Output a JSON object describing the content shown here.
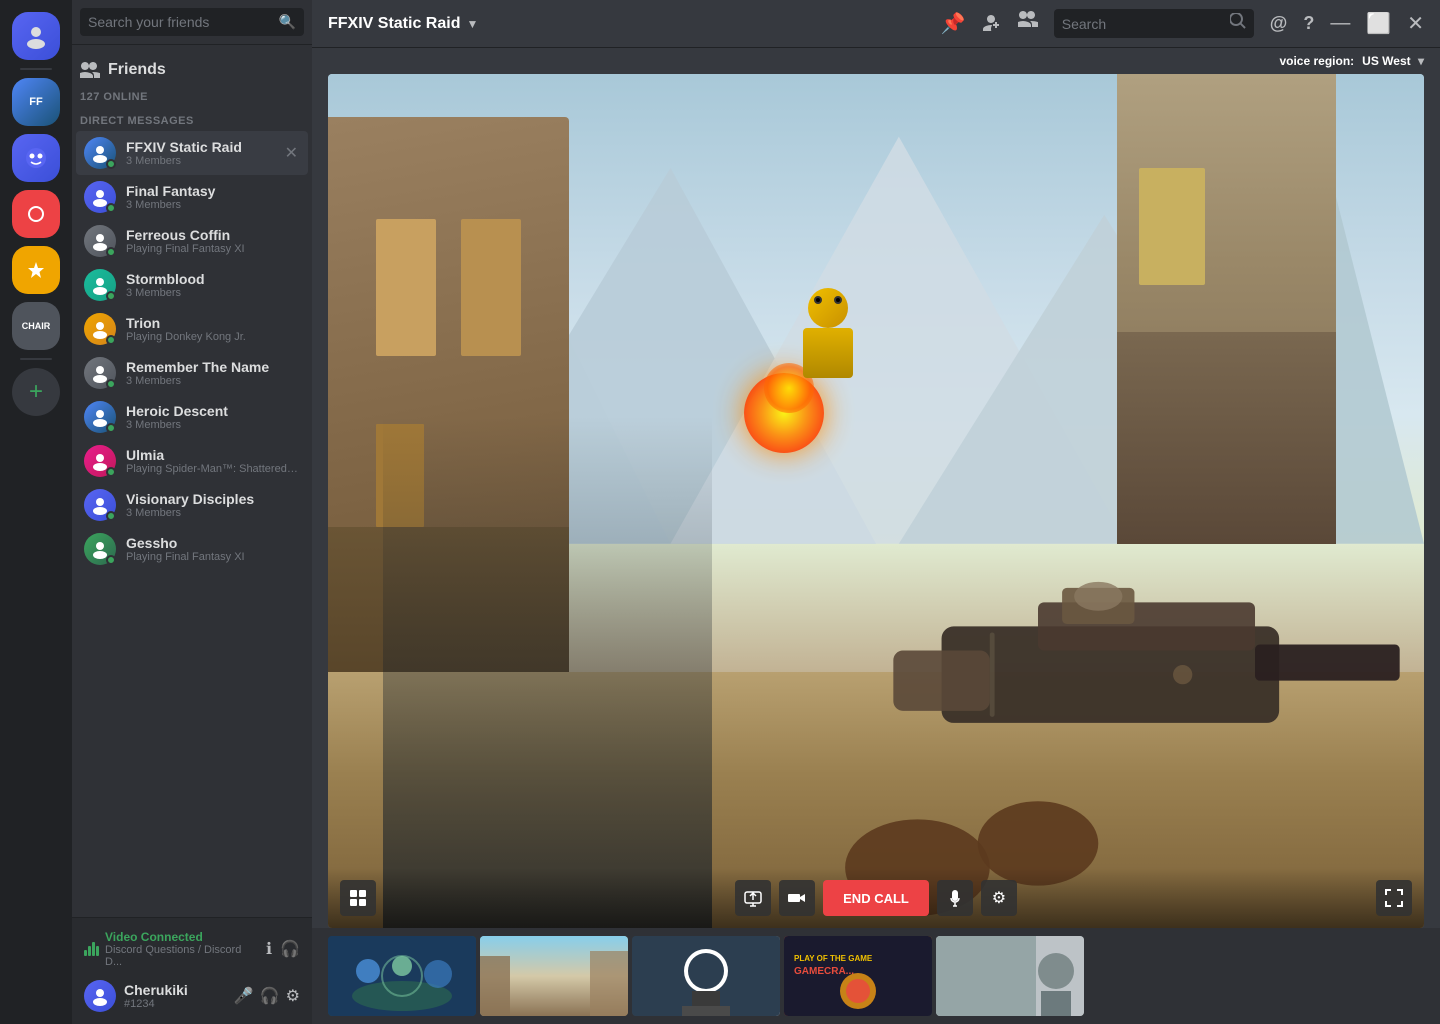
{
  "serverRail": {
    "servers": [
      {
        "id": "home",
        "label": "Home",
        "type": "home"
      },
      {
        "id": "s1",
        "label": "FF",
        "color": "av-blue"
      },
      {
        "id": "s2",
        "label": "Robot",
        "color": "av-purple"
      },
      {
        "id": "s3",
        "label": "Heart",
        "color": "av-red"
      },
      {
        "id": "s4",
        "label": "OW",
        "color": "av-orange"
      },
      {
        "id": "s5",
        "label": "Chair",
        "color": "av-gray"
      }
    ],
    "addLabel": "+"
  },
  "friendsSidebar": {
    "searchPlaceholder": "Search your friends",
    "onlineCount": "127 ONLINE",
    "friendsLabel": "Friends",
    "dmSectionLabel": "DIRECT MESSAGES",
    "dmList": [
      {
        "id": "ffxiv",
        "name": "FFXIV Static Raid",
        "sub": "3 Members",
        "active": true,
        "color": "av-blue"
      },
      {
        "id": "ff",
        "name": "Final Fantasy",
        "sub": "3 Members",
        "active": false,
        "color": "av-purple"
      },
      {
        "id": "ferreous",
        "name": "Ferreous Coffin",
        "sub": "Playing Final Fantasy XI",
        "active": false,
        "color": "av-gray"
      },
      {
        "id": "storm",
        "name": "Stormblood",
        "sub": "3 Members",
        "active": false,
        "color": "av-teal"
      },
      {
        "id": "trion",
        "name": "Trion",
        "sub": "Playing Donkey Kong Jr.",
        "active": false,
        "color": "av-orange"
      },
      {
        "id": "remember",
        "name": "Remember The Name",
        "sub": "3 Members",
        "active": false,
        "color": "av-gray"
      },
      {
        "id": "heroic",
        "name": "Heroic Descent",
        "sub": "3 Members",
        "active": false,
        "color": "av-blue"
      },
      {
        "id": "ulmia",
        "name": "Ulmia",
        "sub": "Playing Spider-Man™: Shattered Dimen...",
        "active": false,
        "color": "av-pink"
      },
      {
        "id": "visionary",
        "name": "Visionary Disciples",
        "sub": "3 Members",
        "active": false,
        "color": "av-purple"
      },
      {
        "id": "gessho",
        "name": "Gessho",
        "sub": "Playing Final Fantasy XI",
        "active": false,
        "color": "av-green"
      }
    ]
  },
  "topBar": {
    "channelName": "FFXIV Static Raid",
    "searchPlaceholder": "Search",
    "voiceRegionLabel": "voice region:",
    "voiceRegion": "US West"
  },
  "videoSection": {
    "endCallLabel": "END CALL"
  },
  "statusBar": {
    "voiceConnectedLabel": "Video Connected",
    "voiceSubLabel": "Discord Questions / Discord D...",
    "userName": "Cherukiki",
    "userTag": "#1234"
  },
  "thumbnails": [
    {
      "id": "t1",
      "class": "thumb1"
    },
    {
      "id": "t2",
      "class": "thumb2"
    },
    {
      "id": "t3",
      "class": "thumb3"
    },
    {
      "id": "t4",
      "class": "thumb4"
    },
    {
      "id": "t5",
      "class": "thumb5"
    }
  ]
}
